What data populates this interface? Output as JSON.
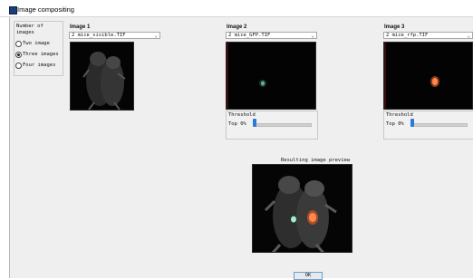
{
  "window": {
    "title": "Image compositing"
  },
  "image_count": {
    "title": "Number of images",
    "options": [
      {
        "label": "Two image",
        "selected": false
      },
      {
        "label": "Three images",
        "selected": true
      },
      {
        "label": "Four images",
        "selected": false
      }
    ]
  },
  "panels": [
    {
      "label": "Image 1",
      "file": "2 mice_visible.TIF"
    },
    {
      "label": "Image 2",
      "file": "2 mice_GFP.TIF",
      "threshold_label": "Threshold",
      "top_label": "Top 0%",
      "threshold_value": 0
    },
    {
      "label": "Image 3",
      "file": "2 mice_rfp.TIF",
      "threshold_label": "Threshold",
      "top_label": "Top 0%",
      "threshold_value": 0
    }
  ],
  "preview": {
    "title": "Resulting image preview"
  },
  "ok_button": {
    "label": "OK"
  }
}
